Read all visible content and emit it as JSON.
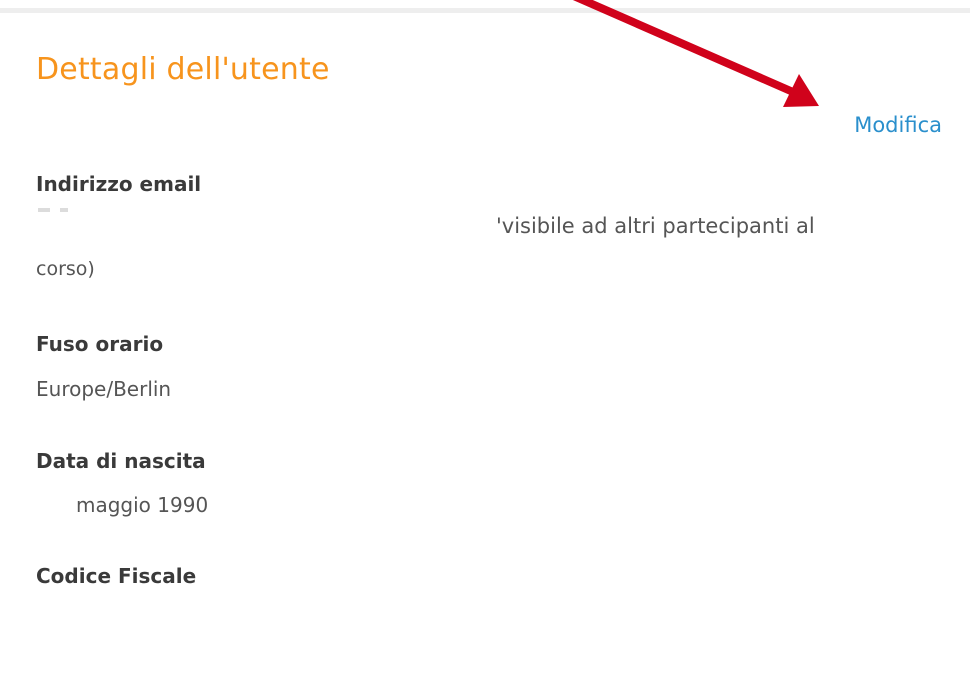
{
  "section": {
    "title": "Dettagli dell'utente",
    "edit_label": "Modifica"
  },
  "fields": {
    "email": {
      "label": "Indirizzo email",
      "visibility_note_line1": "'visibile ad altri partecipanti al",
      "visibility_note_line2": "corso)"
    },
    "timezone": {
      "label": "Fuso orario",
      "value": "Europe/Berlin"
    },
    "birthdate": {
      "label": "Data di nascita",
      "value": "maggio 1990"
    },
    "tax_code": {
      "label": "Codice Fiscale"
    }
  },
  "annotation": {
    "arrow_color": "#d0021b"
  },
  "colors": {
    "accent_orange": "#f7941d",
    "link_blue": "#2a8fcc"
  }
}
